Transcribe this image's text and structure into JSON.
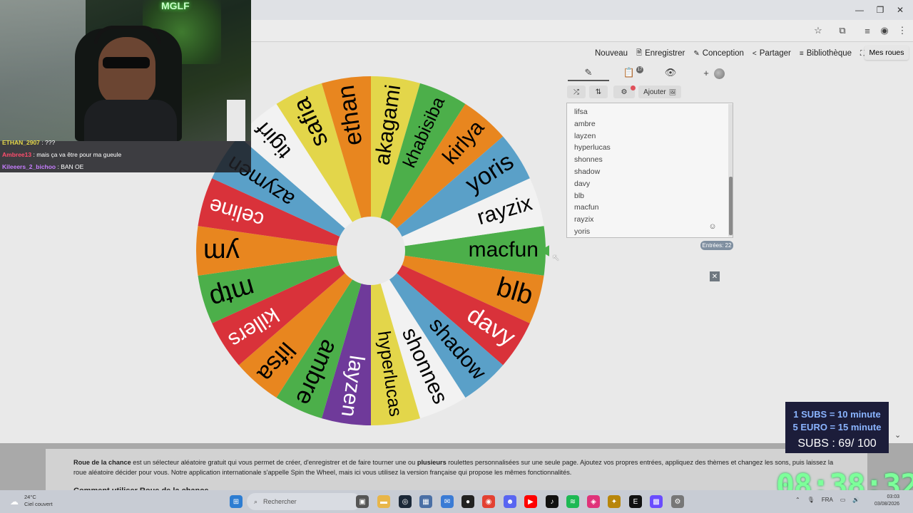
{
  "menu": {
    "items": [
      {
        "icon": "",
        "label": "Nouveau"
      },
      {
        "icon": "🗎",
        "label": "Enregistrer"
      },
      {
        "icon": "✎",
        "label": "Conception"
      },
      {
        "icon": "<",
        "label": "Partager"
      },
      {
        "icon": "≡",
        "label": "Bibliothèque"
      }
    ],
    "fullscreen_icon": "⛶",
    "my_wheels": "Mes roues"
  },
  "tabs": {
    "edit_icon": "✎",
    "results_icon": "📋",
    "results_badge": "17",
    "hide_icon": "👁",
    "add_icon": "+"
  },
  "toolbar": {
    "shuffle_icon": "⤮",
    "sort_icon": "⇅",
    "settings_icon": "⚙",
    "add_label": "Ajouter",
    "add_image_icon": "🖼"
  },
  "entries": {
    "list": [
      "lifsa",
      "ambre",
      "layzen",
      "hyperlucas",
      "shonnes",
      "shadow",
      "davy",
      "blb",
      "macfun",
      "rayzix",
      "yoris"
    ],
    "count_label": "Entrées: 22"
  },
  "wheel": {
    "segments": [
      {
        "label": "macfun",
        "color": "#4caf4a",
        "text": "#000"
      },
      {
        "label": "blb",
        "color": "#e8861f",
        "text": "#000"
      },
      {
        "label": "davy",
        "color": "#d9323a",
        "text": "#fff"
      },
      {
        "label": "shadow",
        "color": "#5aa0c8",
        "text": "#000"
      },
      {
        "label": "shonnes",
        "color": "#f2f2f2",
        "text": "#000"
      },
      {
        "label": "hyperlucas",
        "color": "#e3d64a",
        "text": "#000"
      },
      {
        "label": "layzen",
        "color": "#6f3a9a",
        "text": "#fff"
      },
      {
        "label": "ambre",
        "color": "#4caf4a",
        "text": "#000"
      },
      {
        "label": "lifsa",
        "color": "#e8861f",
        "text": "#000"
      },
      {
        "label": "killers",
        "color": "#d9323a",
        "text": "#fff"
      },
      {
        "label": "mtp",
        "color": "#4caf4a",
        "text": "#000"
      },
      {
        "label": "ym",
        "color": "#e8861f",
        "text": "#000"
      },
      {
        "label": "celine",
        "color": "#d9323a",
        "text": "#fff"
      },
      {
        "label": "azymen",
        "color": "#5aa0c8",
        "text": "#000"
      },
      {
        "label": "tigirf",
        "color": "#f2f2f2",
        "text": "#000"
      },
      {
        "label": "safia",
        "color": "#e3d64a",
        "text": "#000"
      },
      {
        "label": "ethan",
        "color": "#e8861f",
        "text": "#000"
      },
      {
        "label": "akagami",
        "color": "#e3d64a",
        "text": "#000"
      },
      {
        "label": "khabisiba",
        "color": "#4caf4a",
        "text": "#000"
      },
      {
        "label": "kirlya",
        "color": "#e8861f",
        "text": "#000"
      },
      {
        "label": "yoris",
        "color": "#5aa0c8",
        "text": "#000"
      },
      {
        "label": "rayzix",
        "color": "#f2f2f2",
        "text": "#000"
      }
    ],
    "pointer_color": "#4caf4a"
  },
  "stream": {
    "logo_text": "MGLF",
    "chat": [
      {
        "user": "ETHAN_2907",
        "message": ": ???",
        "color": "#e6d84a"
      },
      {
        "user": "Ambree13",
        "message": ": mais ça va être pour ma gueule",
        "color": "#ff4d6d"
      },
      {
        "user": "Kileeers_2_bichoo",
        "message": ": BAN OE",
        "color": "#c77dff"
      }
    ],
    "subs_line1": "1 SUBS = 10 minute",
    "subs_line2": "5 EURO = 15 minute",
    "subs_count": "SUBS : 69/ 100",
    "timer": "08:38:32"
  },
  "description": {
    "app_name": "Roue de la chance",
    "text1": " est un sélecteur aléatoire gratuit qui vous permet de créer, d'enregistrer et de faire tourner une ou ",
    "bold2": "plusieurs",
    "text2": " roulettes personnalisées sur une seule page. Ajoutez vos propres entrées, appliquez des thèmes et changez les sons, puis laissez la roue aléatoire décider pour vous. Notre application internationale s'appelle Spin the Wheel, mais ici vous utilisez la version française qui propose les mêmes fonctionnalités.",
    "howto": "Comment utiliser Roue de la chance"
  },
  "taskbar": {
    "temperature": "24°C",
    "weather": "Ciel couvert",
    "search_placeholder": "Rechercher",
    "language": "FRA",
    "time": "03:03",
    "date": "03/08/2026"
  }
}
